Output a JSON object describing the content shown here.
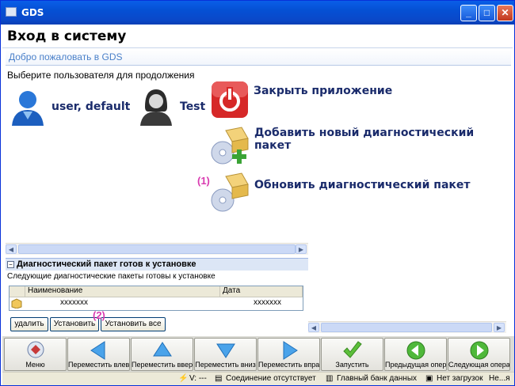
{
  "window": {
    "title": "GDS"
  },
  "header": {
    "title": "Вход в систему"
  },
  "welcome": "Добро пожаловать в GDS",
  "prompt": "Выберите пользователя для продолжения",
  "users": [
    {
      "name": "user, default",
      "icon": "male-user-icon"
    },
    {
      "name": "Test",
      "icon": "female-user-icon"
    }
  ],
  "actions": {
    "close_app": "Закрыть приложение",
    "add_package": "Добавить новый диагностический пакет",
    "update_package": "Обновить диагностический пакет"
  },
  "markers": {
    "m1": "(1)",
    "m2": "(2)"
  },
  "package": {
    "header": "Диагностический пакет готов к установке",
    "subtitle": "Следующие диагностические пакеты готовы к установке",
    "columns": [
      "Наименование",
      "Дата"
    ],
    "rows": [
      {
        "name": "xxxxxxx",
        "date": "xxxxxxx"
      }
    ],
    "buttons": {
      "delete": "удалить",
      "install": "Установить",
      "install_all": "Установить все"
    }
  },
  "toolbar": [
    {
      "label": "Меню",
      "icon": "menu-icon"
    },
    {
      "label": "Переместить влево",
      "icon": "arrow-left-icon"
    },
    {
      "label": "Переместить вверх",
      "icon": "arrow-up-icon"
    },
    {
      "label": "Переместить вниз",
      "icon": "arrow-down-icon"
    },
    {
      "label": "Переместить вправо",
      "icon": "arrow-right-icon"
    },
    {
      "label": "Запустить",
      "icon": "checkmark-icon"
    },
    {
      "label": "Предыдущая операция",
      "icon": "previous-icon"
    },
    {
      "label": "Следующая операция",
      "icon": "next-icon"
    }
  ],
  "status": {
    "voltage": "V: ---",
    "connection": "Соединение отсутствует",
    "bank": "Главный банк данных",
    "downloads": "Нет загрузок",
    "misc": "Не...я"
  },
  "colors": {
    "accent": "#1a2b6b",
    "marker": "#d93bb0",
    "title_bar": "#0550d4"
  }
}
